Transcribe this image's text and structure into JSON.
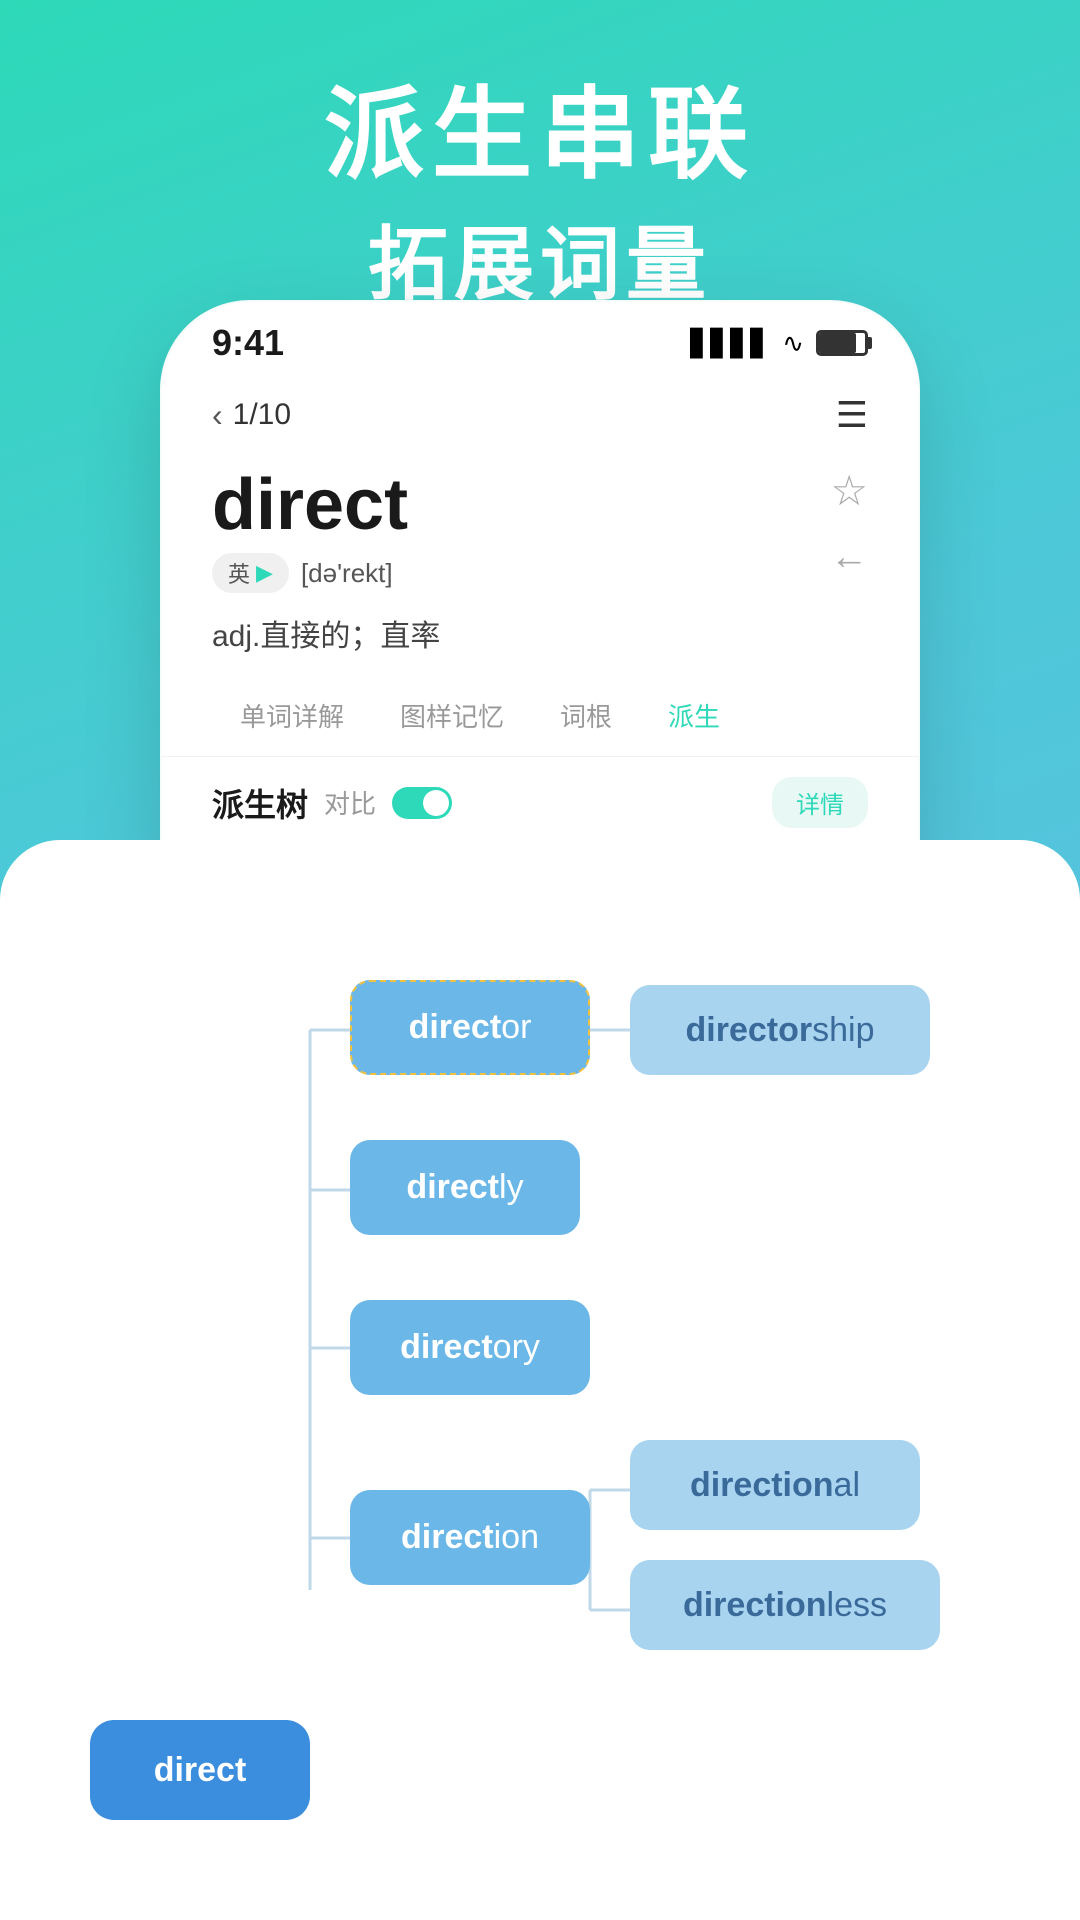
{
  "header": {
    "title_line1": "派生串联",
    "title_line2": "拓展词量"
  },
  "phone": {
    "time": "9:41",
    "nav": {
      "page_indicator": "1/10"
    },
    "word": {
      "text": "direct",
      "phonetic_label": "英",
      "phonetic": "[də'rekt]",
      "meaning": "adj.直接的；直率"
    },
    "tabs": [
      {
        "label": "单词详解",
        "active": false
      },
      {
        "label": "图样记忆",
        "active": false
      },
      {
        "label": "词根",
        "active": false
      },
      {
        "label": "派生",
        "active": true
      }
    ],
    "tree": {
      "title": "派生树",
      "compare_label": "对比",
      "detail_label": "详情",
      "nodes": [
        {
          "id": "direct",
          "text": "direct",
          "bold_end": 6,
          "class": "node-root"
        },
        {
          "id": "director",
          "text": "director",
          "bold_end": 6,
          "class": "node-director"
        },
        {
          "id": "directorship",
          "text": "directorship",
          "bold_end": 8,
          "class": "node-directorship"
        },
        {
          "id": "directly",
          "text": "directly",
          "bold_end": 6,
          "class": "node-directly"
        },
        {
          "id": "directory",
          "text": "directory",
          "bold_end": 6,
          "class": "node-directory"
        },
        {
          "id": "direction",
          "text": "direction",
          "bold_end": 9,
          "class": "node-direction"
        },
        {
          "id": "directional",
          "text": "directional",
          "bold_end": 9,
          "class": "node-directional"
        },
        {
          "id": "directionless",
          "text": "directionless",
          "bold_end": 9,
          "class": "node-directionless"
        }
      ]
    }
  }
}
